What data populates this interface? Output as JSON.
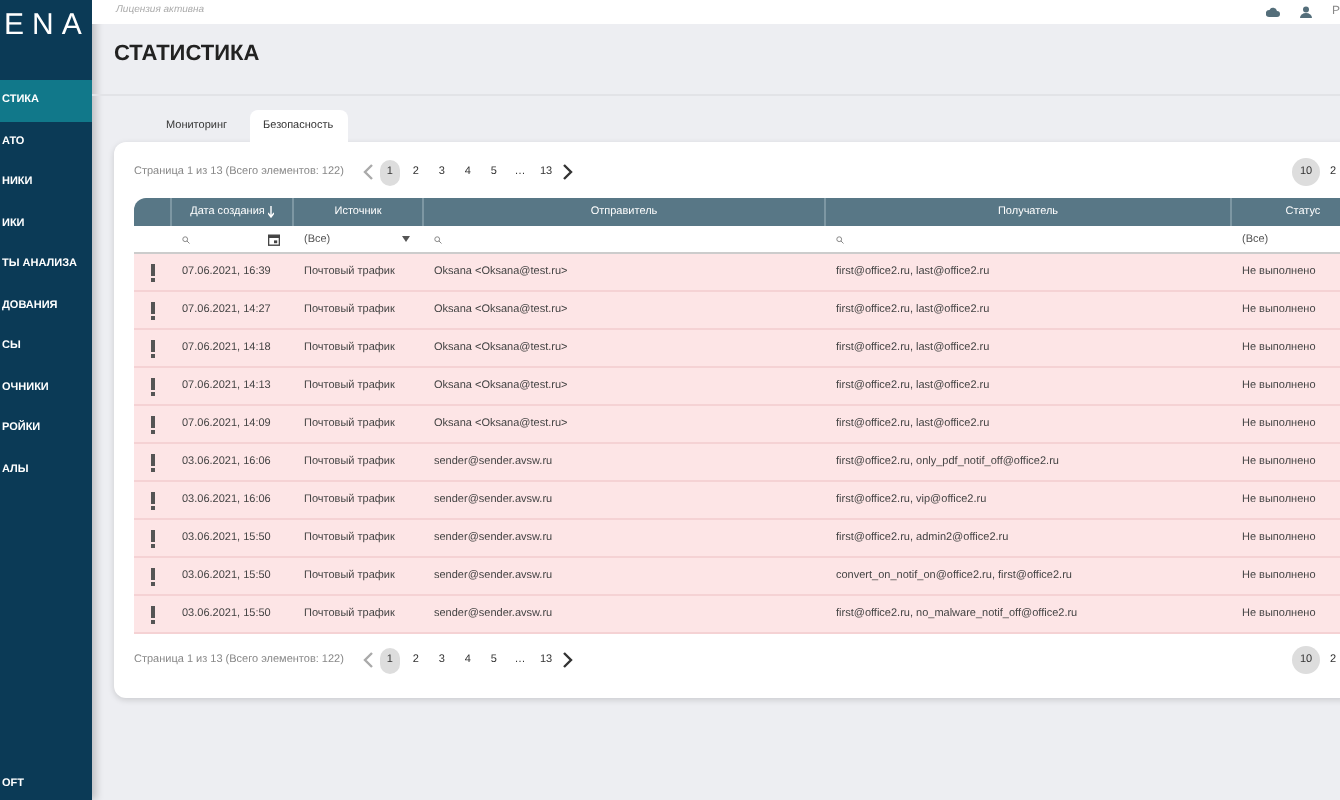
{
  "sidebar": {
    "logo": "ENA",
    "items": [
      {
        "label": "СТИКА",
        "selected": true
      },
      {
        "label": "АТО",
        "selected": false
      },
      {
        "label": "НИКИ",
        "selected": false
      },
      {
        "label": "ИКИ",
        "selected": false
      },
      {
        "label": "ТЫ АНАЛИЗА",
        "selected": false
      },
      {
        "label": "ДОВАНИЯ",
        "selected": false
      },
      {
        "label": "СЫ",
        "selected": false
      },
      {
        "label": "ОЧНИКИ",
        "selected": false
      },
      {
        "label": "РОЙКИ",
        "selected": false
      },
      {
        "label": "АЛЫ",
        "selected": false
      }
    ],
    "footer": "OFT"
  },
  "topbar": {
    "license": "Лицензия активна",
    "user": "Р"
  },
  "page_title": "СТАТИСТИКА",
  "tabs": [
    {
      "label": "Мониторинг",
      "selected": false
    },
    {
      "label": "Безопасность",
      "selected": true
    }
  ],
  "pager_top": {
    "summary": "Страница 1 из 13 (Всего элементов: 122)",
    "pages": [
      {
        "label": "1",
        "selected": true
      },
      {
        "label": "2",
        "selected": false
      },
      {
        "label": "3",
        "selected": false
      },
      {
        "label": "4",
        "selected": false
      },
      {
        "label": "5",
        "selected": false
      },
      {
        "label": "…",
        "selected": false
      },
      {
        "label": "13",
        "selected": false
      }
    ],
    "page_sizes": [
      {
        "label": "10",
        "selected": true
      },
      {
        "label": "2",
        "selected": false
      }
    ]
  },
  "table": {
    "columns": [
      "Дата создания",
      "Источник",
      "Отправитель",
      "Получатель",
      "Статус"
    ],
    "filters": {
      "source": "(Все)",
      "status": "(Все)"
    },
    "rows": [
      {
        "flagged": true,
        "date": "07.06.2021, 16:39",
        "source": "Почтовый трафик",
        "sender": "Oksana <Oksana@test.ru>",
        "recipient": "first@office2.ru, last@office2.ru",
        "status": "Не выполнено"
      },
      {
        "flagged": true,
        "date": "07.06.2021, 14:27",
        "source": "Почтовый трафик",
        "sender": "Oksana <Oksana@test.ru>",
        "recipient": "first@office2.ru, last@office2.ru",
        "status": "Не выполнено"
      },
      {
        "flagged": true,
        "date": "07.06.2021, 14:18",
        "source": "Почтовый трафик",
        "sender": "Oksana <Oksana@test.ru>",
        "recipient": "first@office2.ru, last@office2.ru",
        "status": "Не выполнено"
      },
      {
        "flagged": true,
        "date": "07.06.2021, 14:13",
        "source": "Почтовый трафик",
        "sender": "Oksana <Oksana@test.ru>",
        "recipient": "first@office2.ru, last@office2.ru",
        "status": "Не выполнено"
      },
      {
        "flagged": true,
        "date": "07.06.2021, 14:09",
        "source": "Почтовый трафик",
        "sender": "Oksana <Oksana@test.ru>",
        "recipient": "first@office2.ru, last@office2.ru",
        "status": "Не выполнено"
      },
      {
        "flagged": true,
        "date": "03.06.2021, 16:06",
        "source": "Почтовый трафик",
        "sender": "sender@sender.avsw.ru",
        "recipient": "first@office2.ru, only_pdf_notif_off@office2.ru",
        "status": "Не выполнено"
      },
      {
        "flagged": true,
        "date": "03.06.2021, 16:06",
        "source": "Почтовый трафик",
        "sender": "sender@sender.avsw.ru",
        "recipient": "first@office2.ru, vip@office2.ru",
        "status": "Не выполнено"
      },
      {
        "flagged": true,
        "date": "03.06.2021, 15:50",
        "source": "Почтовый трафик",
        "sender": "sender@sender.avsw.ru",
        "recipient": "first@office2.ru, admin2@office2.ru",
        "status": "Не выполнено"
      },
      {
        "flagged": true,
        "date": "03.06.2021, 15:50",
        "source": "Почтовый трафик",
        "sender": "sender@sender.avsw.ru",
        "recipient": "convert_on_notif_on@office2.ru, first@office2.ru",
        "status": "Не выполнено"
      },
      {
        "flagged": true,
        "date": "03.06.2021, 15:50",
        "source": "Почтовый трафик",
        "sender": "sender@sender.avsw.ru",
        "recipient": "first@office2.ru, no_malware_notif_off@office2.ru",
        "status": "Не выполнено"
      }
    ]
  },
  "pager_bottom": {
    "summary": "Страница 1 из 13 (Всего элементов: 122)",
    "pages": [
      {
        "label": "1",
        "selected": true
      },
      {
        "label": "2",
        "selected": false
      },
      {
        "label": "3",
        "selected": false
      },
      {
        "label": "4",
        "selected": false
      },
      {
        "label": "5",
        "selected": false
      },
      {
        "label": "…",
        "selected": false
      },
      {
        "label": "13",
        "selected": false
      }
    ],
    "page_sizes": [
      {
        "label": "10",
        "selected": true
      },
      {
        "label": "2",
        "selected": false
      }
    ]
  }
}
